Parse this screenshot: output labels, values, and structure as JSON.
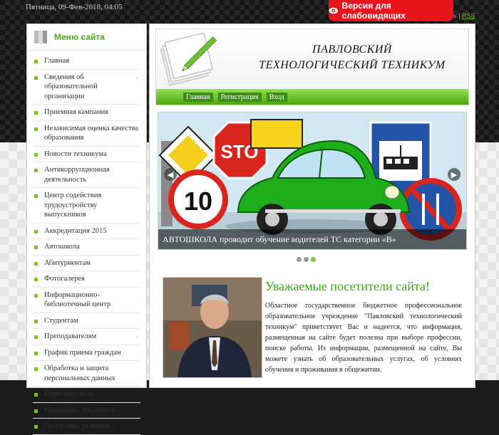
{
  "top_bar": {
    "datetime": "Пятница, 09-Фев-2018, 04:05",
    "vision_button": "Версия для слабовидящих",
    "rss_prefix": "ь |",
    "rss_label": "RSS"
  },
  "sidebar": {
    "title": "Меню сайта",
    "items": [
      {
        "label": "Главная",
        "has_submenu": false
      },
      {
        "label": "Сведения об образовательной организации",
        "has_submenu": true
      },
      {
        "label": "Приемная кампания",
        "has_submenu": false
      },
      {
        "label": "Независимая оценка качества образования",
        "has_submenu": false
      },
      {
        "label": "Новости техникума",
        "has_submenu": false
      },
      {
        "label": "Антикоррупционная деятельность",
        "has_submenu": false
      },
      {
        "label": "Центр содействия трудоустройству выпускников",
        "has_submenu": false
      },
      {
        "label": "Аккредитация 2015",
        "has_submenu": false
      },
      {
        "label": "Автошкола",
        "has_submenu": false
      },
      {
        "label": "Абитуриентам",
        "has_submenu": false
      },
      {
        "label": "Фотогалерея",
        "has_submenu": false
      },
      {
        "label": "Информационно-библиотечный центр",
        "has_submenu": false
      },
      {
        "label": "Студентам",
        "has_submenu": false
      },
      {
        "label": "Преподавателям",
        "has_submenu": true
      },
      {
        "label": "График приема граждан",
        "has_submenu": false
      },
      {
        "label": "Обработка и защита персональных данных",
        "has_submenu": false
      },
      {
        "label": "Обратная связь",
        "has_submenu": false
      },
      {
        "label": "WorldSkills Ульяновск",
        "has_submenu": false
      },
      {
        "label": "Программа развития",
        "has_submenu": false
      }
    ]
  },
  "header": {
    "title_line1": "ПАВЛОВСКИЙ",
    "title_line2": "ТЕХНОЛОГИЧЕСКИЙ ТЕХНИКУМ",
    "nav": [
      "Главная",
      "Регистрация",
      "Вход"
    ]
  },
  "slider": {
    "caption": "АВТОШКОЛА проводит обучение водителей ТС категории «В»",
    "sign_stop": "STO",
    "sign_speed": "10",
    "slide_count": 3,
    "active_slide": 3
  },
  "welcome": {
    "title": "Уважаемые посетители сайта!",
    "text": "Областное государственное бюджетное профессиональное образовательное учреждение \"Павловский технологический техникум\" приветствует Вас и надеется, что информация, размещенная на сайте будет полезна при выборе профессии, поиске работы. Из информации, размещенной на сайте, Вы можете узнать об образовательных услугах, об условиях обучения и проживания в общежитии."
  },
  "colors": {
    "accent_green": "#5aa423",
    "vision_red": "#e8161c",
    "nav_green": "#4fa514"
  }
}
